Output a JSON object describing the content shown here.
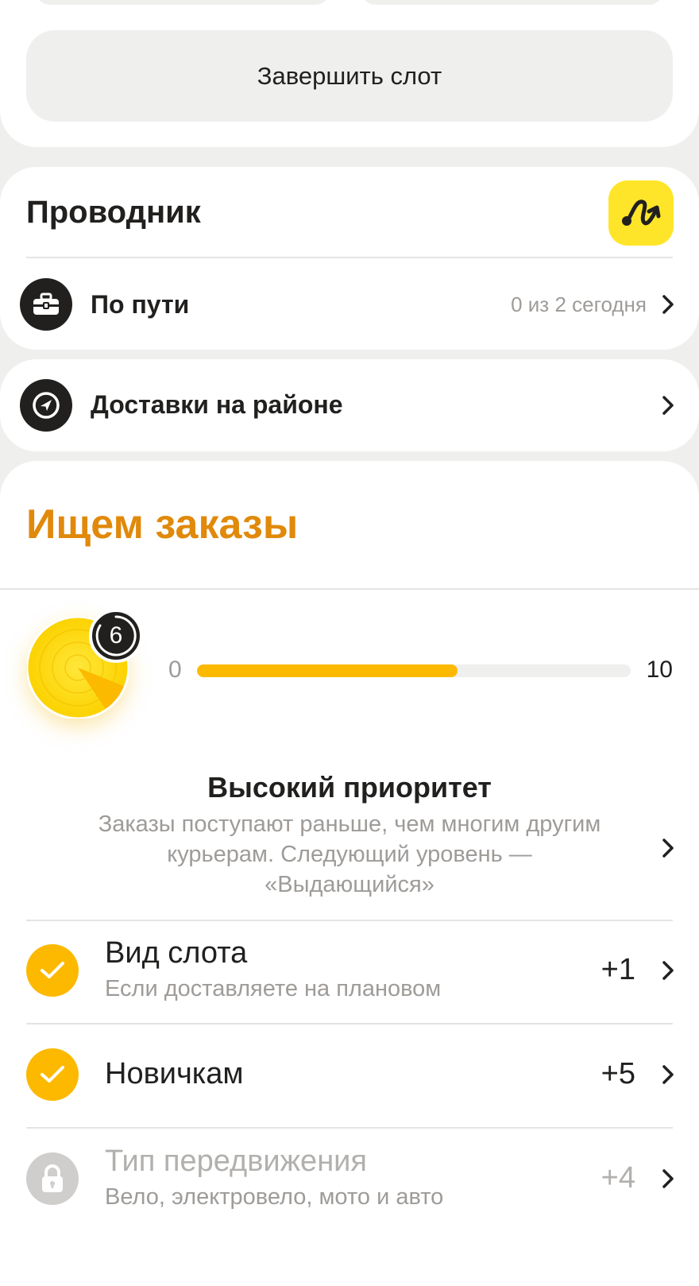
{
  "top_card": {
    "finish_slot_label": "Завершить слот"
  },
  "guide": {
    "title": "Проводник",
    "logo_icon": "route-squiggle-icon",
    "logo_color": "#ffe529",
    "rows": [
      {
        "label": "По пути",
        "meta": "0 из 2 сегодня",
        "icon": "briefcase-icon"
      },
      {
        "label": "Доставки на районе",
        "meta": "",
        "icon": "navigation-arrow-icon"
      }
    ]
  },
  "orders": {
    "title": "Ищем заказы",
    "title_color": "#e0890b",
    "level": "6",
    "progress": {
      "min": "0",
      "max": "10",
      "fill_fraction": 0.6,
      "color": "#fcb900"
    },
    "priority": {
      "title": "Высокий приоритет",
      "description": "Заказы поступают раньше, чем многим другим курьерам. Следующий уровень — «Выдающийся»"
    },
    "items": [
      {
        "title": "Вид слота",
        "subtitle": "Если доставляете на плановом",
        "bonus": "+1",
        "status": "checked",
        "icon": "check-icon"
      },
      {
        "title": "Новичкам",
        "subtitle": "",
        "bonus": "+5",
        "status": "checked",
        "icon": "check-icon"
      },
      {
        "title": "Тип передвижения",
        "subtitle": "Вело, электровело, мото и авто",
        "bonus": "+4",
        "status": "locked",
        "icon": "lock-icon"
      }
    ]
  }
}
